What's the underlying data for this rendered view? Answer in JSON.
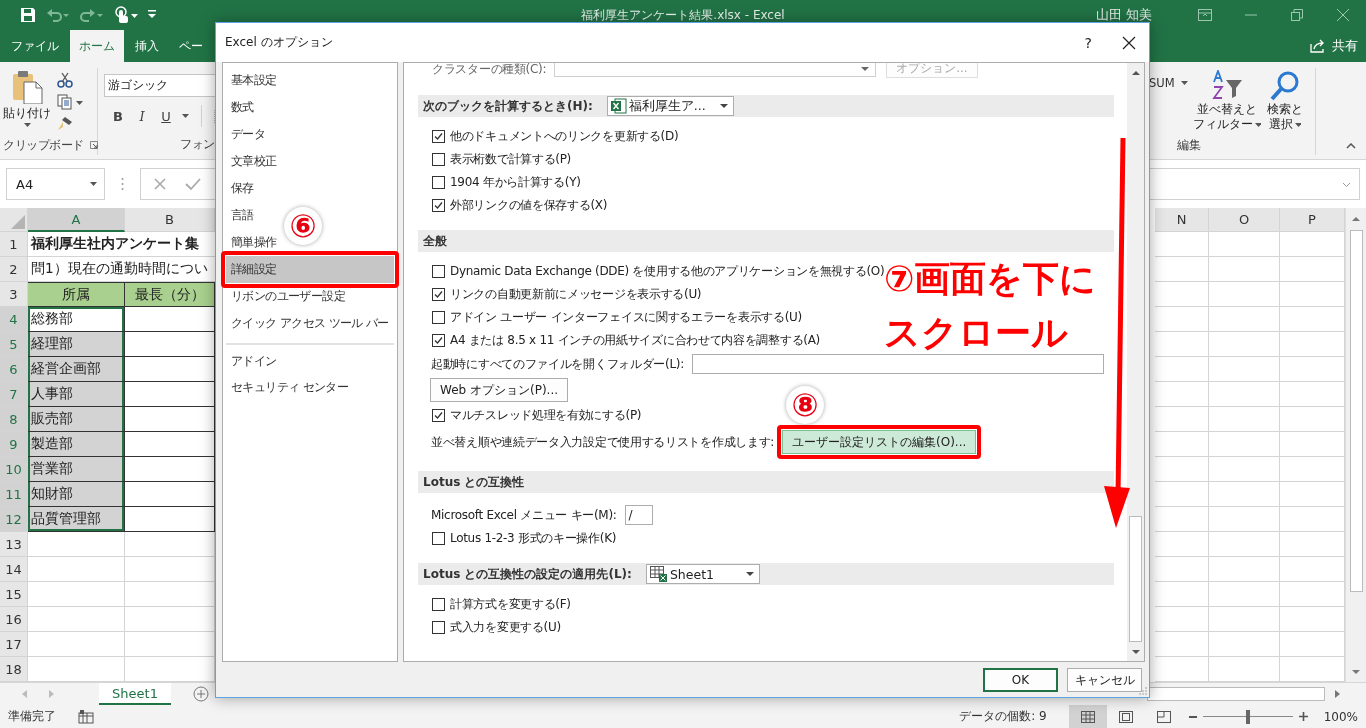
{
  "window": {
    "title": "福利厚生アンケート結果.xlsx - Excel",
    "user": "山田 知美"
  },
  "ribbon_tabs": [
    {
      "label": "ファイル",
      "selected": false
    },
    {
      "label": "ホーム",
      "selected": true
    },
    {
      "label": "挿入",
      "selected": false
    },
    {
      "label": "ペー",
      "selected": false
    }
  ],
  "share": "共有",
  "ribbon": {
    "clipboard": {
      "paste": "貼り付け",
      "label": "クリップボード"
    },
    "font": {
      "name": "游ゴシック",
      "bold": "B",
      "italic": "I",
      "underline": "U",
      "label": "フォン"
    },
    "editing": {
      "autosum": "SUM",
      "sort": [
        "並べ替えと",
        "フィルター"
      ],
      "find": [
        "検索と",
        "選択"
      ],
      "label": "編集"
    }
  },
  "formula_bar": {
    "name_box": "A4"
  },
  "sheet": {
    "columns": [
      {
        "label": "A",
        "selected": true
      },
      {
        "label": "B",
        "selected": false
      },
      {
        "label": "N",
        "selected": false
      },
      {
        "label": "O",
        "selected": false
      },
      {
        "label": "P",
        "selected": false
      }
    ],
    "rows": [
      {
        "number": "1",
        "kind": "title",
        "a": "福利厚生社内アンケート集",
        "selected": false
      },
      {
        "number": "2",
        "kind": "question",
        "a": "問1）現在の通勤時間につい",
        "selected": false
      },
      {
        "number": "3",
        "kind": "header",
        "a": "所属",
        "b": "最長（分）",
        "selected": false
      },
      {
        "number": "4",
        "kind": "data",
        "a": "総務部",
        "selected": true
      },
      {
        "number": "5",
        "kind": "data",
        "a": "経理部",
        "selected": true
      },
      {
        "number": "6",
        "kind": "data",
        "a": "経営企画部",
        "selected": true
      },
      {
        "number": "7",
        "kind": "data",
        "a": "人事部",
        "selected": true
      },
      {
        "number": "8",
        "kind": "data",
        "a": "販売部",
        "selected": true
      },
      {
        "number": "9",
        "kind": "data",
        "a": "製造部",
        "selected": true
      },
      {
        "number": "10",
        "kind": "data",
        "a": "営業部",
        "selected": true
      },
      {
        "number": "11",
        "kind": "data",
        "a": "知財部",
        "selected": true
      },
      {
        "number": "12",
        "kind": "data",
        "a": "品質管理部",
        "selected": true
      },
      {
        "number": "13",
        "kind": "empty",
        "selected": false
      },
      {
        "number": "14",
        "kind": "empty",
        "selected": false
      },
      {
        "number": "15",
        "kind": "empty",
        "selected": false
      },
      {
        "number": "16",
        "kind": "empty",
        "selected": false
      },
      {
        "number": "17",
        "kind": "empty",
        "selected": false
      },
      {
        "number": "18",
        "kind": "empty",
        "selected": false
      }
    ]
  },
  "sheet_tabs": [
    {
      "label": "Sheet1",
      "selected": true
    }
  ],
  "status_bar": {
    "ready": "準備完了",
    "count": "データの個数: 9",
    "views": [
      {
        "selected": true
      },
      {
        "selected": false
      },
      {
        "selected": false
      }
    ],
    "zoom_slider": {
      "level": 0.5
    },
    "zoom": "100%"
  },
  "dialog": {
    "title": "Excel のオプション",
    "help": "?",
    "nav": [
      {
        "label": "基本設定",
        "selected": false,
        "divider_before": false,
        "callout": false
      },
      {
        "label": "数式",
        "selected": false,
        "divider_before": false,
        "callout": false
      },
      {
        "label": "データ",
        "selected": false,
        "divider_before": false,
        "callout": false
      },
      {
        "label": "文章校正",
        "selected": false,
        "divider_before": false,
        "callout": false
      },
      {
        "label": "保存",
        "selected": false,
        "divider_before": false,
        "callout": false
      },
      {
        "label": "言語",
        "selected": false,
        "divider_before": false,
        "callout": false
      },
      {
        "label": "簡単操作",
        "selected": false,
        "divider_before": false,
        "callout": false
      },
      {
        "label": "詳細設定",
        "selected": true,
        "divider_before": false,
        "callout": true
      },
      {
        "label": "リボンのユーザー設定",
        "selected": false,
        "divider_before": false,
        "callout": false
      },
      {
        "label": "クイック アクセス ツール バー",
        "selected": false,
        "divider_before": false,
        "callout": false
      },
      {
        "label": "アドイン",
        "selected": false,
        "divider_before": true,
        "callout": false
      },
      {
        "label": "セキュリティ センター",
        "selected": false,
        "divider_before": false,
        "callout": false
      }
    ],
    "items": [
      {
        "kind": "dropdown_row",
        "label": "クラスターの種類(C):",
        "button": "オプション...",
        "disabled": true
      },
      {
        "kind": "header",
        "label": "次のブックを計算するとき(H):",
        "dropdown": {
          "value": "福利厚生ア..."
        }
      },
      {
        "kind": "checkbox",
        "label": "他のドキュメントへのリンクを更新する(D)",
        "checked": true
      },
      {
        "kind": "checkbox",
        "label": "表示桁数で計算する(P)",
        "checked": false
      },
      {
        "kind": "checkbox",
        "label": "1904 年から計算する(Y)",
        "checked": false
      },
      {
        "kind": "checkbox",
        "label": "外部リンクの値を保存する(X)",
        "checked": true
      },
      {
        "kind": "header",
        "label": "全般"
      },
      {
        "kind": "checkbox",
        "label": "Dynamic Data Exchange (DDE) を使用する他のアプリケーションを無視する(O)",
        "checked": false
      },
      {
        "kind": "checkbox",
        "label": "リンクの自動更新前にメッセージを表示する(U)",
        "checked": true
      },
      {
        "kind": "checkbox",
        "label": "アドイン ユーザー インターフェイスに関するエラーを表示する(U)",
        "checked": false
      },
      {
        "kind": "checkbox",
        "label": "A4 または 8.5 x 11 インチの用紙サイズに合わせて内容を調整する(A)",
        "checked": true
      },
      {
        "kind": "text_field",
        "label": "起動時にすべてのファイルを開くフォルダー(L):"
      },
      {
        "kind": "button",
        "label": "Web オプション(P)..."
      },
      {
        "kind": "checkbox",
        "label": "マルチスレッド処理を有効にする(P)",
        "checked": true
      },
      {
        "kind": "label_button",
        "label": "並べ替え順や連続データ入力設定で使用するリストを作成します:",
        "button": {
          "label": "ユーザー設定リストの編集(O)...",
          "hover": true,
          "callout": true
        }
      },
      {
        "kind": "header",
        "label": "Lotus との互換性"
      },
      {
        "kind": "text_field",
        "label": "Microsoft Excel メニュー キー(M):",
        "value": "/"
      },
      {
        "kind": "checkbox",
        "label": "Lotus 1-2-3 形式のキー操作(K)",
        "checked": false
      },
      {
        "kind": "header",
        "label": "Lotus との互換性の設定の適用先(L):",
        "dropdown": {
          "value": "Sheet1"
        }
      },
      {
        "kind": "checkbox",
        "label": "計算方式を変更する(F)",
        "checked": false
      },
      {
        "kind": "checkbox",
        "label": "式入力を変更する(U)",
        "checked": false
      }
    ],
    "buttons": [
      {
        "label": "OK",
        "default": true
      },
      {
        "label": "キャンセル",
        "default": false
      }
    ]
  },
  "annotations": [
    {
      "kind": "step",
      "text": "⑥"
    },
    {
      "kind": "caption",
      "lines": [
        "⑦画面を下に",
        "スクロール"
      ]
    },
    {
      "kind": "step",
      "text": "⑧"
    },
    {
      "kind": "arrow"
    }
  ]
}
